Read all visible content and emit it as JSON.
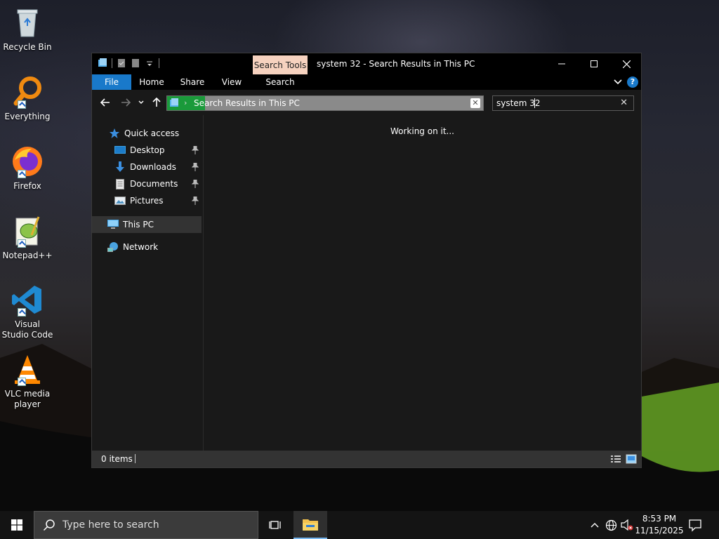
{
  "desktop": {
    "icons": [
      {
        "label": "Recycle Bin",
        "icon": "recycle-bin-icon"
      },
      {
        "label": "Everything",
        "icon": "everything-icon"
      },
      {
        "label": "Firefox",
        "icon": "firefox-icon"
      },
      {
        "label": "Notepad++",
        "icon": "notepad-plus-plus-icon"
      },
      {
        "label": "Visual Studio Code",
        "icon": "vscode-icon"
      },
      {
        "label": "VLC media player",
        "icon": "vlc-icon"
      }
    ]
  },
  "window": {
    "title": "system 32 - Search Results in This PC",
    "contextual_tab": "Search Tools",
    "ribbon_tabs": [
      "File",
      "Home",
      "Share",
      "View",
      "Search"
    ],
    "address": {
      "text": "Search Results in This PC"
    },
    "search": {
      "value": "system 32"
    },
    "nav_pane": {
      "quick_access": "Quick access",
      "pinned": [
        "Desktop",
        "Downloads",
        "Documents",
        "Pictures"
      ],
      "this_pc": "This PC",
      "network": "Network"
    },
    "content_status": "Working on it...",
    "status_bar": {
      "items": "0 items"
    },
    "colors": {
      "file_tab": "#1979ca",
      "contextual_tab": "#f6d2bf",
      "address_highlight": "#1a9a3a"
    }
  },
  "taskbar": {
    "search_placeholder": "Type here to search",
    "time": "8:53 PM",
    "date": "11/15/2025"
  }
}
